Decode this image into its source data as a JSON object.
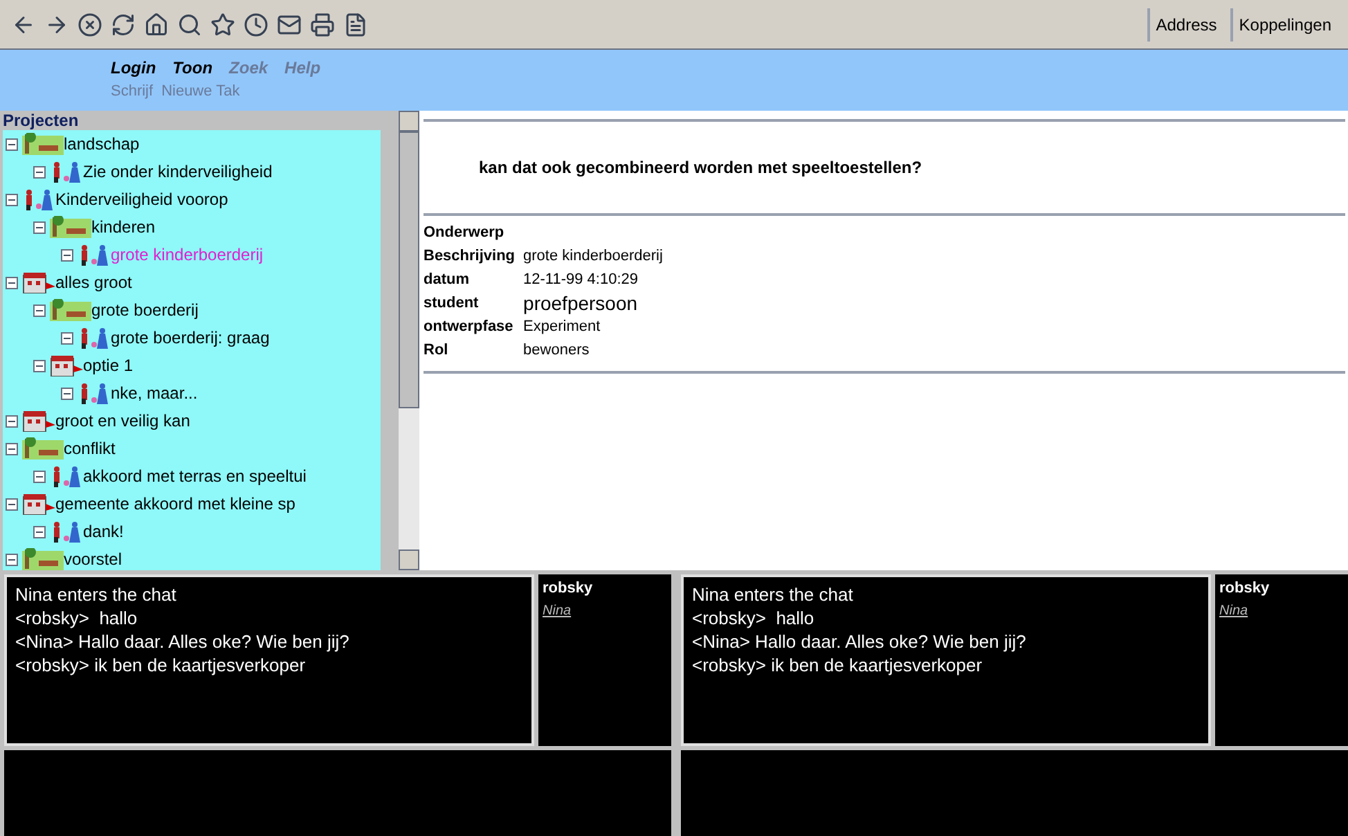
{
  "toolbar": {
    "right_buttons": [
      "Address",
      "Koppelingen"
    ]
  },
  "menu": {
    "top": [
      {
        "label": "Login",
        "enabled": true
      },
      {
        "label": "Toon",
        "enabled": true
      },
      {
        "label": "Zoek",
        "enabled": false
      },
      {
        "label": "Help",
        "enabled": false
      }
    ],
    "sub": [
      "Schrijf",
      "Nieuwe Tak"
    ]
  },
  "tree": {
    "title": "Projecten",
    "items": [
      {
        "label": "landschap",
        "kind": "landscape",
        "selected": false,
        "children": [
          {
            "label": "Zie onder kinderveiligheid",
            "kind": "people",
            "selected": false
          }
        ]
      },
      {
        "label": "Kinderveiligheid voorop",
        "kind": "people",
        "selected": false,
        "children": [
          {
            "label": "kinderen",
            "kind": "landscape",
            "selected": false,
            "children": [
              {
                "label": "grote kinderboerderij",
                "kind": "people",
                "selected": true
              }
            ]
          }
        ]
      },
      {
        "label": "alles groot",
        "kind": "building",
        "selected": false,
        "children": [
          {
            "label": "grote boerderij",
            "kind": "landscape",
            "selected": false,
            "children": [
              {
                "label": "grote boerderij: graag",
                "kind": "people",
                "selected": false
              }
            ]
          },
          {
            "label": "optie 1",
            "kind": "building",
            "selected": false,
            "children": [
              {
                "label": "nke, maar...",
                "kind": "people",
                "selected": false
              }
            ]
          }
        ]
      },
      {
        "label": "groot en veilig kan",
        "kind": "building",
        "selected": false
      },
      {
        "label": "conflikt",
        "kind": "landscape",
        "selected": false,
        "children": [
          {
            "label": "akkoord met terras en speeltui",
            "kind": "people",
            "selected": false
          }
        ]
      },
      {
        "label": "gemeente akkoord met kleine sp",
        "kind": "building",
        "selected": false,
        "children": [
          {
            "label": "dank!",
            "kind": "people",
            "selected": false
          }
        ]
      },
      {
        "label": "voorstel",
        "kind": "landscape",
        "selected": false
      }
    ]
  },
  "detail": {
    "question": "kan dat ook gecombineerd worden met speeltoestellen?",
    "fields": [
      {
        "label": "Onderwerp"
      },
      {
        "label": "Beschrijving",
        "value": "grote kinderboerderij"
      },
      {
        "label": "datum",
        "value": "12-11-99 4:10:29"
      },
      {
        "label": "student",
        "value": "proefpersoon"
      },
      {
        "label": "ontwerpfase",
        "value": "Experiment"
      },
      {
        "label": "Rol",
        "value": "bewoners"
      }
    ]
  },
  "chats": [
    {
      "messages": [
        "Nina enters the chat",
        "<robsky>  hallo",
        "<Nina> Hallo daar. Alles oke? Wie ben jij?",
        "<robsky> ik ben de kaartjesverkoper"
      ],
      "users": [
        {
          "name": "robsky",
          "kind": "self"
        },
        {
          "name": "Nina",
          "kind": "link"
        }
      ]
    },
    {
      "messages": [
        "Nina enters the chat",
        "<robsky>  hallo",
        "<Nina> Hallo daar. Alles oke? Wie ben jij?",
        "<robsky> ik ben de kaartjesverkoper"
      ],
      "users": [
        {
          "name": "robsky",
          "kind": "self"
        },
        {
          "name": "Nina",
          "kind": "link"
        }
      ]
    }
  ]
}
